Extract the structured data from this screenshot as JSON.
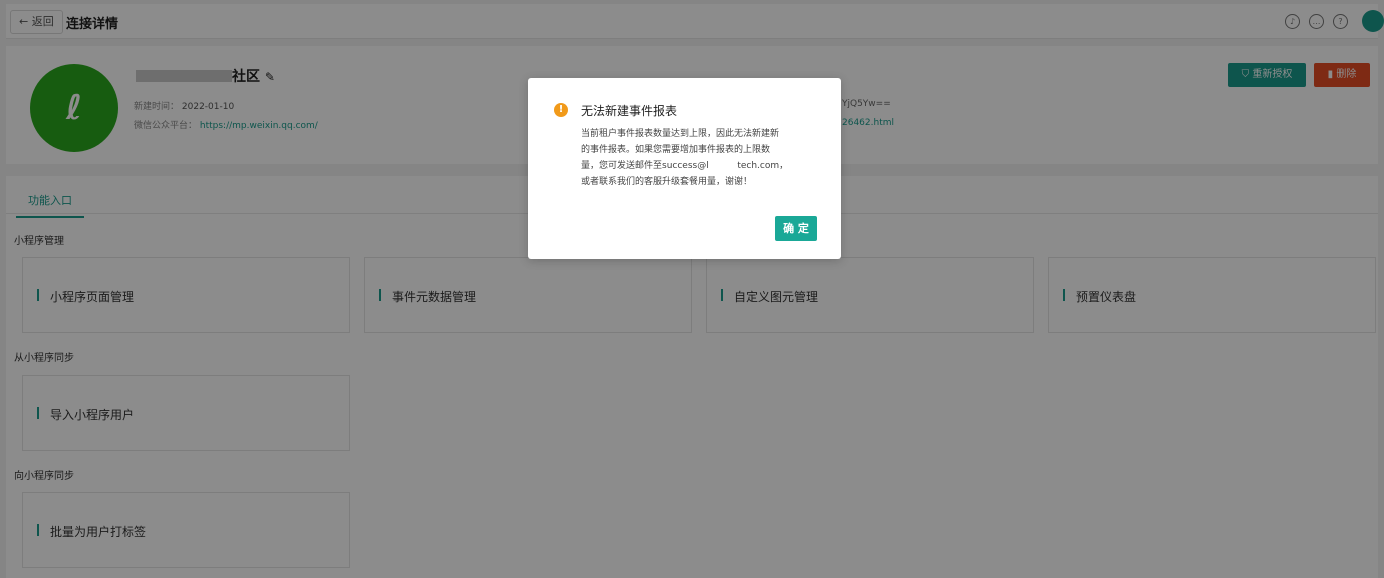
{
  "topbar": {
    "back_label": "← 返回",
    "title": "连接详情",
    "icons": [
      "bell-icon",
      "message-icon",
      "help-icon",
      "user-avatar"
    ]
  },
  "header": {
    "name_suffix": "社区",
    "created_label": "新建时间：",
    "created_value": "2022-01-10",
    "platform_label": "微信公众平台：",
    "platform_link": "https://mp.weixin.qq.com/",
    "appid_fragment": "YjQ5Yw==",
    "link_fragment": "26462.html",
    "reauth_label": "重新授权",
    "delete_label": "删除"
  },
  "tabs": [
    {
      "label": "功能入口",
      "active": true
    }
  ],
  "sections": [
    {
      "title": "小程序管理",
      "cards": [
        "小程序页面管理",
        "事件元数据管理",
        "自定义图元管理",
        "预置仪表盘"
      ]
    },
    {
      "title": "从小程序同步",
      "cards": [
        "导入小程序用户"
      ]
    },
    {
      "title": "向小程序同步",
      "cards": [
        "批量为用户打标签"
      ]
    }
  ],
  "modal": {
    "title": "无法新建事件报表",
    "body_lines": [
      "当前租户事件报表数量达到上限，因此无法新建新",
      "的事件报表。如果您需要增加事件报表的上限数",
      "量，您可发送邮件至success@l          tech.com，",
      "或者联系我们的客服升级套餐用量，谢谢！"
    ],
    "ok_label": "确 定"
  },
  "colors": {
    "accent": "#1a9c8c",
    "danger": "#e54d26",
    "warning": "#f19a1a",
    "logo": "#2aa81e"
  }
}
